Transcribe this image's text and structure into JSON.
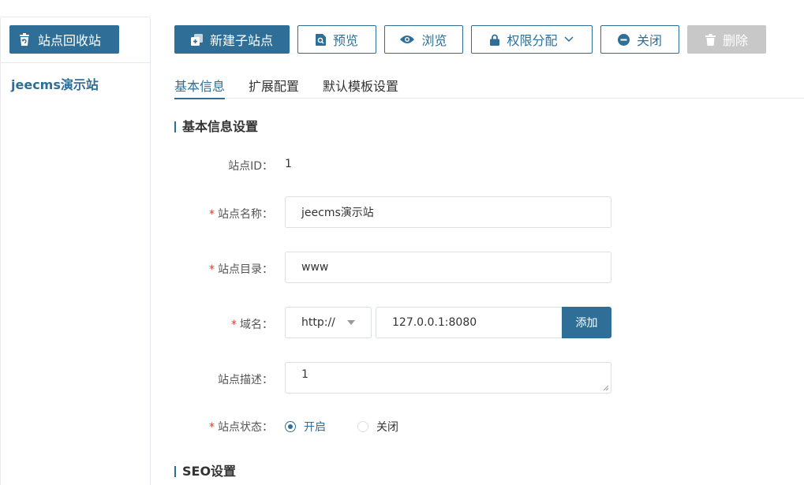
{
  "sidebar": {
    "recycle_label": "站点回收站",
    "site_name": "jeecms演示站"
  },
  "toolbar": {
    "new_sub_site": "新建子站点",
    "preview": "预览",
    "browse": "浏览",
    "permission": "权限分配",
    "close": "关闭",
    "delete": "删除"
  },
  "tabs": [
    "基本信息",
    "扩展配置",
    "默认模板设置"
  ],
  "sections": {
    "basic": "基本信息设置",
    "seo": "SEO设置"
  },
  "form": {
    "site_id_label": "站点ID：",
    "site_id_value": "1",
    "name_label": "站点名称：",
    "name_value": "jeecms演示站",
    "dir_label": "站点目录：",
    "dir_value": "www",
    "domain_label": "域名：",
    "protocol_value": "http://",
    "domain_value": "127.0.0.1:8080",
    "add_label": "添加",
    "desc_label": "站点描述：",
    "desc_value": "1",
    "status_label": "站点状态：",
    "status_on": "开启",
    "status_off": "关闭",
    "required_mark": "*"
  },
  "colors": {
    "primary": "#2f6f97",
    "disabled": "#c8c8c8",
    "required": "#e4393c"
  }
}
